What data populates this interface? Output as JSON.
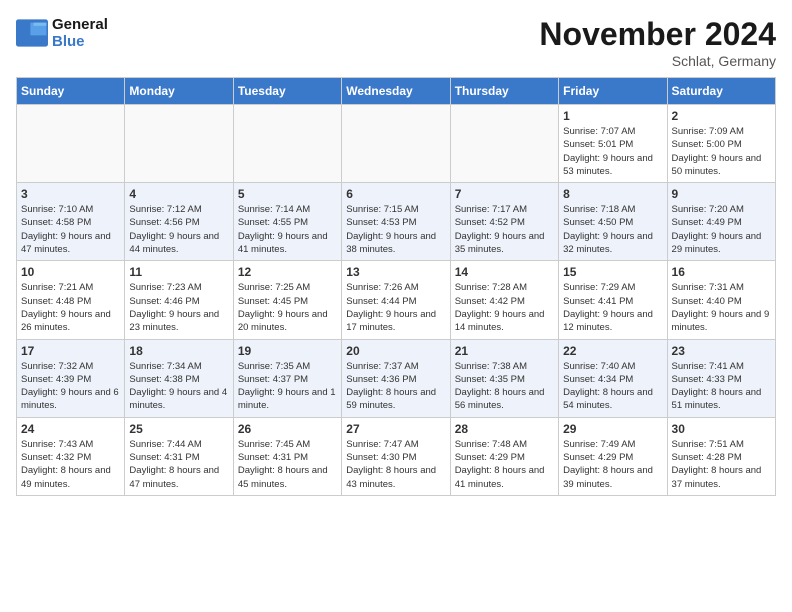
{
  "header": {
    "logo_line1": "General",
    "logo_line2": "Blue",
    "month_title": "November 2024",
    "location": "Schlat, Germany"
  },
  "days_of_week": [
    "Sunday",
    "Monday",
    "Tuesday",
    "Wednesday",
    "Thursday",
    "Friday",
    "Saturday"
  ],
  "weeks": [
    {
      "row_index": 0,
      "days": [
        {
          "date": "",
          "info": ""
        },
        {
          "date": "",
          "info": ""
        },
        {
          "date": "",
          "info": ""
        },
        {
          "date": "",
          "info": ""
        },
        {
          "date": "",
          "info": ""
        },
        {
          "date": "1",
          "info": "Sunrise: 7:07 AM\nSunset: 5:01 PM\nDaylight: 9 hours and 53 minutes."
        },
        {
          "date": "2",
          "info": "Sunrise: 7:09 AM\nSunset: 5:00 PM\nDaylight: 9 hours and 50 minutes."
        }
      ]
    },
    {
      "row_index": 1,
      "days": [
        {
          "date": "3",
          "info": "Sunrise: 7:10 AM\nSunset: 4:58 PM\nDaylight: 9 hours and 47 minutes."
        },
        {
          "date": "4",
          "info": "Sunrise: 7:12 AM\nSunset: 4:56 PM\nDaylight: 9 hours and 44 minutes."
        },
        {
          "date": "5",
          "info": "Sunrise: 7:14 AM\nSunset: 4:55 PM\nDaylight: 9 hours and 41 minutes."
        },
        {
          "date": "6",
          "info": "Sunrise: 7:15 AM\nSunset: 4:53 PM\nDaylight: 9 hours and 38 minutes."
        },
        {
          "date": "7",
          "info": "Sunrise: 7:17 AM\nSunset: 4:52 PM\nDaylight: 9 hours and 35 minutes."
        },
        {
          "date": "8",
          "info": "Sunrise: 7:18 AM\nSunset: 4:50 PM\nDaylight: 9 hours and 32 minutes."
        },
        {
          "date": "9",
          "info": "Sunrise: 7:20 AM\nSunset: 4:49 PM\nDaylight: 9 hours and 29 minutes."
        }
      ]
    },
    {
      "row_index": 2,
      "days": [
        {
          "date": "10",
          "info": "Sunrise: 7:21 AM\nSunset: 4:48 PM\nDaylight: 9 hours and 26 minutes."
        },
        {
          "date": "11",
          "info": "Sunrise: 7:23 AM\nSunset: 4:46 PM\nDaylight: 9 hours and 23 minutes."
        },
        {
          "date": "12",
          "info": "Sunrise: 7:25 AM\nSunset: 4:45 PM\nDaylight: 9 hours and 20 minutes."
        },
        {
          "date": "13",
          "info": "Sunrise: 7:26 AM\nSunset: 4:44 PM\nDaylight: 9 hours and 17 minutes."
        },
        {
          "date": "14",
          "info": "Sunrise: 7:28 AM\nSunset: 4:42 PM\nDaylight: 9 hours and 14 minutes."
        },
        {
          "date": "15",
          "info": "Sunrise: 7:29 AM\nSunset: 4:41 PM\nDaylight: 9 hours and 12 minutes."
        },
        {
          "date": "16",
          "info": "Sunrise: 7:31 AM\nSunset: 4:40 PM\nDaylight: 9 hours and 9 minutes."
        }
      ]
    },
    {
      "row_index": 3,
      "days": [
        {
          "date": "17",
          "info": "Sunrise: 7:32 AM\nSunset: 4:39 PM\nDaylight: 9 hours and 6 minutes."
        },
        {
          "date": "18",
          "info": "Sunrise: 7:34 AM\nSunset: 4:38 PM\nDaylight: 9 hours and 4 minutes."
        },
        {
          "date": "19",
          "info": "Sunrise: 7:35 AM\nSunset: 4:37 PM\nDaylight: 9 hours and 1 minute."
        },
        {
          "date": "20",
          "info": "Sunrise: 7:37 AM\nSunset: 4:36 PM\nDaylight: 8 hours and 59 minutes."
        },
        {
          "date": "21",
          "info": "Sunrise: 7:38 AM\nSunset: 4:35 PM\nDaylight: 8 hours and 56 minutes."
        },
        {
          "date": "22",
          "info": "Sunrise: 7:40 AM\nSunset: 4:34 PM\nDaylight: 8 hours and 54 minutes."
        },
        {
          "date": "23",
          "info": "Sunrise: 7:41 AM\nSunset: 4:33 PM\nDaylight: 8 hours and 51 minutes."
        }
      ]
    },
    {
      "row_index": 4,
      "days": [
        {
          "date": "24",
          "info": "Sunrise: 7:43 AM\nSunset: 4:32 PM\nDaylight: 8 hours and 49 minutes."
        },
        {
          "date": "25",
          "info": "Sunrise: 7:44 AM\nSunset: 4:31 PM\nDaylight: 8 hours and 47 minutes."
        },
        {
          "date": "26",
          "info": "Sunrise: 7:45 AM\nSunset: 4:31 PM\nDaylight: 8 hours and 45 minutes."
        },
        {
          "date": "27",
          "info": "Sunrise: 7:47 AM\nSunset: 4:30 PM\nDaylight: 8 hours and 43 minutes."
        },
        {
          "date": "28",
          "info": "Sunrise: 7:48 AM\nSunset: 4:29 PM\nDaylight: 8 hours and 41 minutes."
        },
        {
          "date": "29",
          "info": "Sunrise: 7:49 AM\nSunset: 4:29 PM\nDaylight: 8 hours and 39 minutes."
        },
        {
          "date": "30",
          "info": "Sunrise: 7:51 AM\nSunset: 4:28 PM\nDaylight: 8 hours and 37 minutes."
        }
      ]
    }
  ]
}
